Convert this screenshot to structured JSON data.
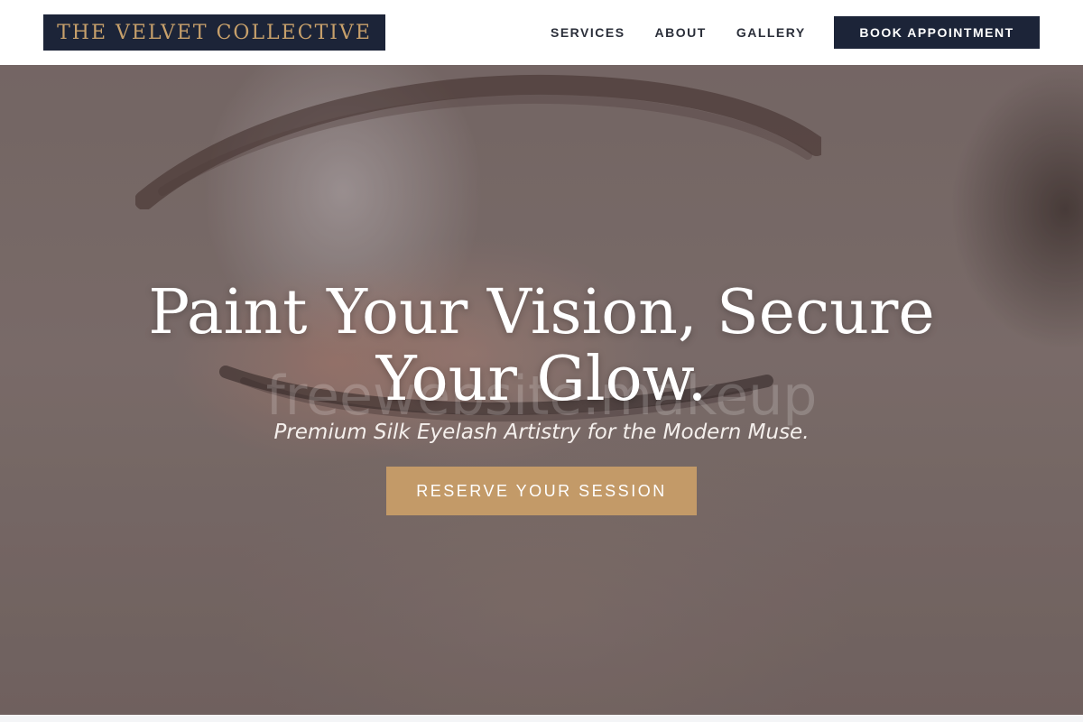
{
  "header": {
    "logo_text": "THE VELVET COLLECTIVE",
    "nav": [
      {
        "label": "SERVICES"
      },
      {
        "label": "ABOUT"
      },
      {
        "label": "GALLERY"
      }
    ],
    "book_label": "BOOK APPOINTMENT"
  },
  "hero": {
    "title": "Paint Your Vision, Secure Your Glow.",
    "subtitle": "Premium Silk Eyelash Artistry for the Modern Muse.",
    "watermark": "freewebsite.makeup",
    "cta_label": "RESERVE YOUR SESSION"
  },
  "colors": {
    "navy": "#1c2438",
    "gold": "#c7a06b",
    "cta_gold": "#c39a68",
    "nav_text": "#2b2f3a"
  }
}
